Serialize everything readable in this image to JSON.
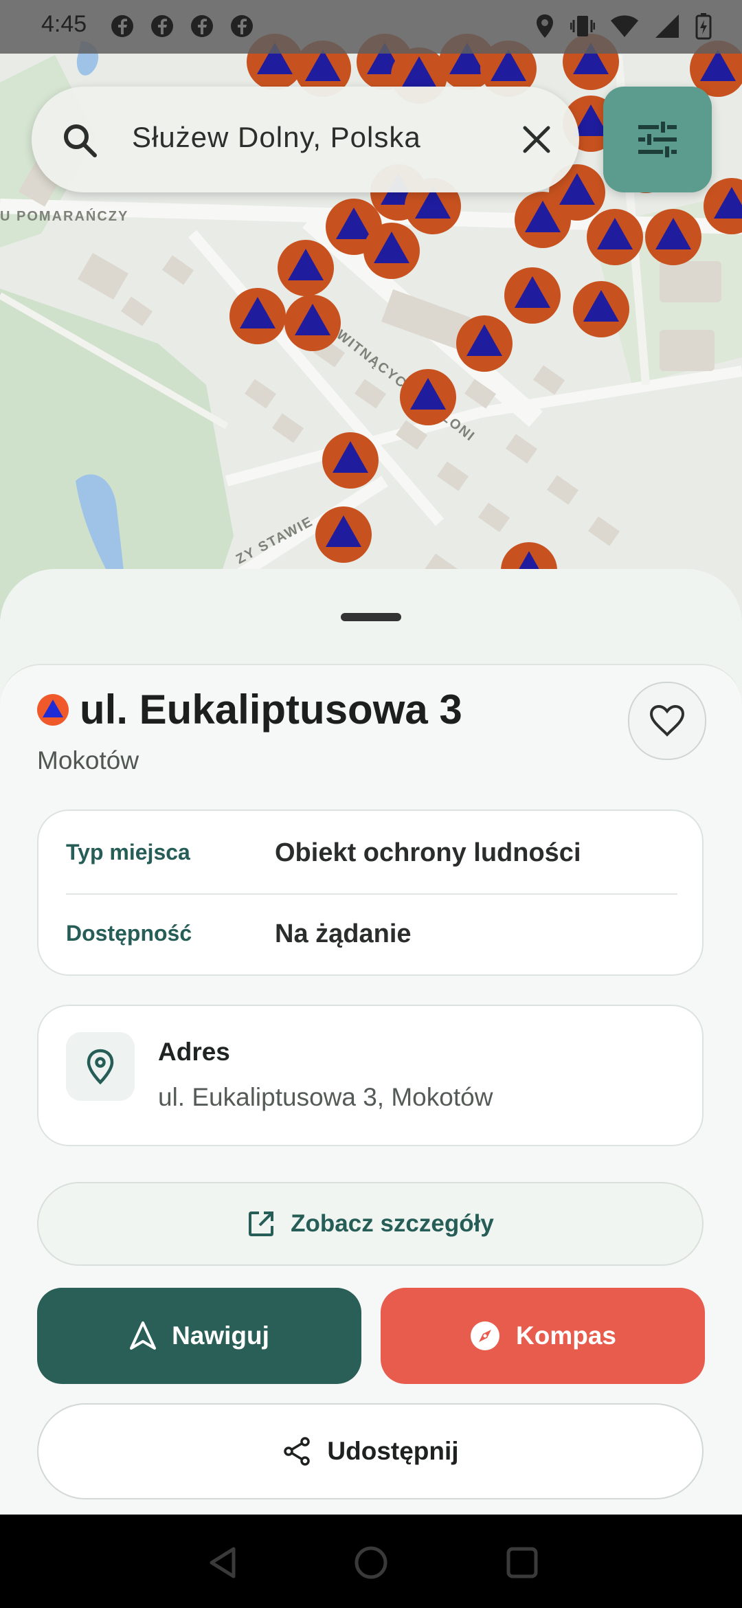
{
  "status_bar": {
    "time": "4:45",
    "left_icons": [
      "facebook-icon",
      "facebook-icon",
      "facebook-icon",
      "facebook-icon"
    ],
    "right_icons": [
      "location-icon",
      "vibrate-icon",
      "wifi-icon",
      "signal-icon",
      "battery-charging-icon"
    ]
  },
  "map": {
    "street_labels": [
      "U POMARAŃCZY",
      "KWITNĄCYCH JABŁONI",
      "ZY STAWIE"
    ],
    "marker_icon": "civil-defense-marker",
    "colors": {
      "marker_outer": "#c8521f",
      "marker_triangle": "#1f1c9e",
      "background": "#e8ebe6"
    }
  },
  "search": {
    "value": "Służew Dolny, Polska",
    "icon": "search-icon",
    "clear_icon": "close-icon"
  },
  "filter_button": {
    "icon": "tune-icon",
    "color": "#5c9c8e"
  },
  "place": {
    "title": "ul. Eukaliptusowa 3",
    "district": "Mokotów",
    "details": [
      {
        "key": "Typ miejsca",
        "value": "Obiekt ochrony ludności"
      },
      {
        "key": "Dostępność",
        "value": "Na żądanie"
      }
    ],
    "address_label": "Adres",
    "address_value": "ul. Eukaliptusowa 3, Mokotów"
  },
  "actions": {
    "details_label": "Zobacz szczegóły",
    "navigate_label": "Nawiguj",
    "compass_label": "Kompas",
    "share_label": "Udostępnij",
    "colors": {
      "primary": "#295f56",
      "compass": "#e85c4e"
    }
  },
  "nav_bar": {
    "icons": [
      "back-icon",
      "home-icon",
      "recents-icon"
    ]
  }
}
